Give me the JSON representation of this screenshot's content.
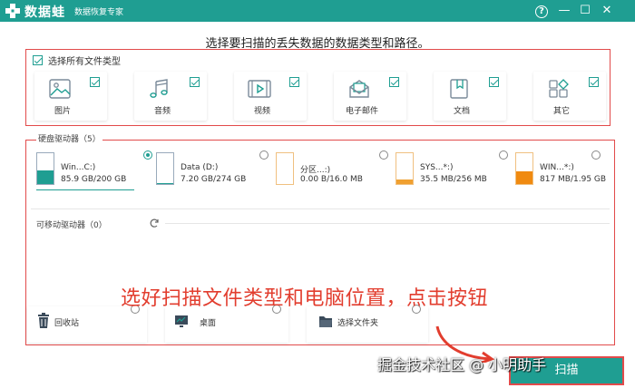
{
  "app": {
    "name": "数据蛙",
    "subtitle": "数据恢复专家",
    "help_glyph": "?",
    "min_glyph": "—",
    "max_glyph": "☐",
    "close_glyph": "✕"
  },
  "instruction": "选择要扫描的丢失数据的数据类型和路径。",
  "file_types": {
    "select_all_label": "选择所有文件类型",
    "select_all_checked": true,
    "items": [
      {
        "label": "图片",
        "icon": "image-icon",
        "checked": true
      },
      {
        "label": "音频",
        "icon": "music-icon",
        "checked": true
      },
      {
        "label": "视频",
        "icon": "video-icon",
        "checked": true
      },
      {
        "label": "电子邮件",
        "icon": "email-icon",
        "checked": true
      },
      {
        "label": "文档",
        "icon": "document-icon",
        "checked": true
      },
      {
        "label": "其它",
        "icon": "other-icon",
        "checked": true
      }
    ]
  },
  "hard_drives": {
    "label": "硬盘驱动器（5）",
    "items": [
      {
        "name": "Win...C:)",
        "size": "85.9 GB/200 GB",
        "used_fraction": 0.43,
        "fill": "#1f9e92",
        "selected": true
      },
      {
        "name": "Data (D:)",
        "size": "7.20 GB/274 GB",
        "used_fraction": 0.03,
        "fill": "#1f9e92",
        "selected": false
      },
      {
        "name": "分区...:)",
        "size": "0.00  B/16.0 MB",
        "used_fraction": 0.0,
        "fill": "#f0a030",
        "selected": false
      },
      {
        "name": "SYS...*:)",
        "size": "35.5 MB/256 MB",
        "used_fraction": 0.14,
        "fill": "#f0a030",
        "selected": false
      },
      {
        "name": "WIN...*:)",
        "size": "817 MB/1.95 GB",
        "used_fraction": 0.42,
        "fill": "#f08a10",
        "selected": false
      }
    ]
  },
  "removable": {
    "label": "可移动驱动器（0）"
  },
  "locations": [
    {
      "label": "回收站",
      "icon": "recycle-bin-icon"
    },
    {
      "label": "桌面",
      "icon": "desktop-icon"
    },
    {
      "label": "选择文件夹",
      "icon": "folder-icon"
    }
  ],
  "annotation": "选好扫描文件类型和电脑位置，点击按钮",
  "next_button": "扫描",
  "watermark": "掘金技术社区 @ 小明助手",
  "colors": {
    "brand": "#1f9e92",
    "highlight": "#e24b4b",
    "annotation": "#e23d2e"
  }
}
